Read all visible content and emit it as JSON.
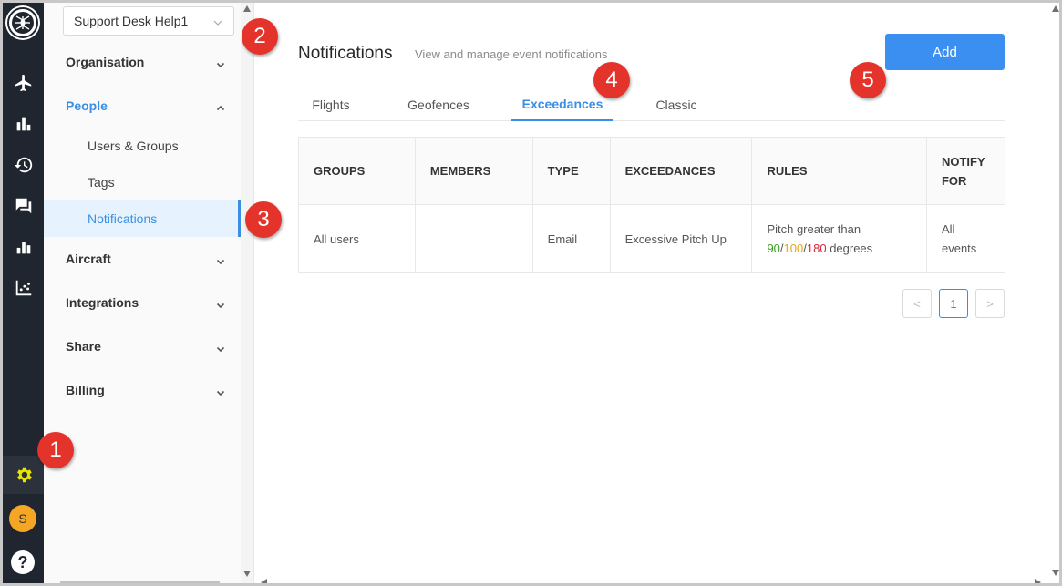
{
  "workspace_select": {
    "value": "Support Desk Help1"
  },
  "rail": {
    "icons": [
      "logo-icon",
      "airplane-icon",
      "bar-chart-icon",
      "history-icon",
      "chat-icon",
      "stats-icon",
      "scatter-icon",
      "gear-icon",
      "avatar",
      "help-icon"
    ],
    "avatar_initial": "S",
    "help_label": "?",
    "active_color": "#e6e600"
  },
  "menu": {
    "sections": [
      {
        "label": "Organisation",
        "expanded": false
      },
      {
        "label": "People",
        "expanded": true,
        "items": [
          "Users & Groups",
          "Tags",
          "Notifications"
        ],
        "selected": "Notifications"
      },
      {
        "label": "Aircraft",
        "expanded": false
      },
      {
        "label": "Integrations",
        "expanded": false
      },
      {
        "label": "Share",
        "expanded": false
      },
      {
        "label": "Billing",
        "expanded": false
      }
    ]
  },
  "header": {
    "title": "Notifications",
    "subtitle": "View and manage event notifications",
    "add_label": "Add"
  },
  "tabs": [
    {
      "label": "Flights"
    },
    {
      "label": "Geofences"
    },
    {
      "label": "Exceedances",
      "active": true
    },
    {
      "label": "Classic"
    }
  ],
  "table": {
    "columns": [
      "GROUPS",
      "MEMBERS",
      "TYPE",
      "EXCEEDANCES",
      "RULES",
      "NOTIFY FOR"
    ],
    "rows": [
      {
        "groups": "All users",
        "members": "",
        "type": "Email",
        "exceedances": "Excessive Pitch Up",
        "rules_prefix": "Pitch greater than",
        "rule_low": "90",
        "rule_mid": "100",
        "rule_high": "180",
        "rule_sep": "/",
        "rules_suffix": "degrees",
        "notify_for": "All events"
      }
    ]
  },
  "pagination": {
    "prev": "<",
    "current": "1",
    "next": ">"
  },
  "badges": [
    "1",
    "2",
    "3",
    "4",
    "5"
  ],
  "colors": {
    "accent": "#3a8ee6",
    "add_button": "#3b8ff0",
    "badge": "#e4332b",
    "rule_low": "#3b9a1e",
    "rule_mid": "#e8a317",
    "rule_high": "#d7263d"
  }
}
